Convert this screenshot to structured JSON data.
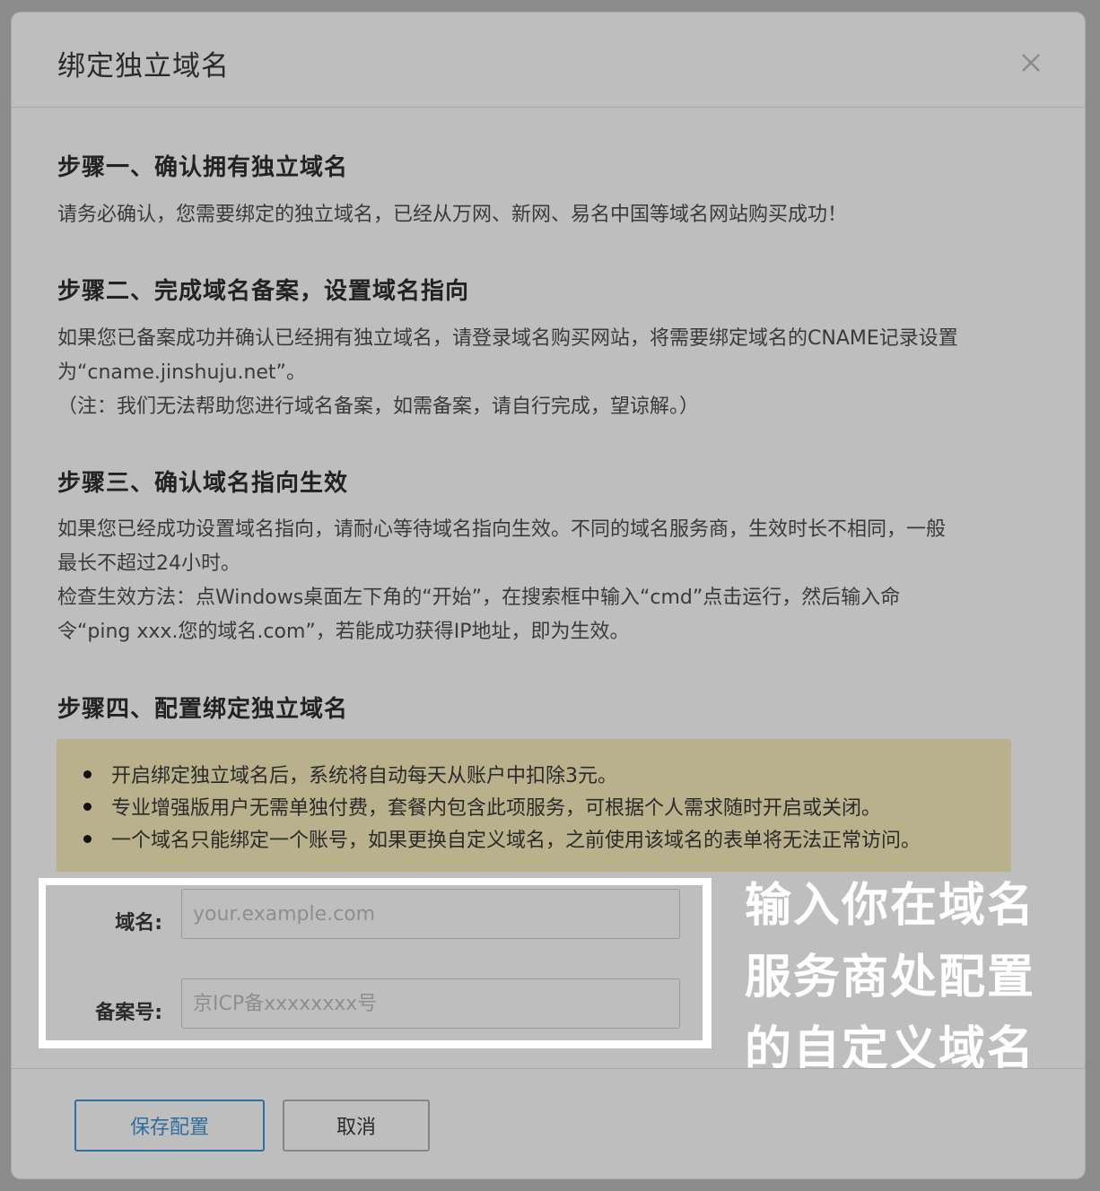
{
  "dialog": {
    "title": "绑定独立域名",
    "close_icon": "close-icon"
  },
  "steps": [
    {
      "title": "步骤一、确认拥有独立域名",
      "lines": [
        "请务必确认，您需要绑定的独立域名，已经从万网、新网、易名中国等域名网站购买成功！"
      ]
    },
    {
      "title": "步骤二、完成域名备案，设置域名指向",
      "lines": [
        "如果您已备案成功并确认已经拥有独立域名，请登录域名购买网站，将需要绑定域名的CNAME记录设置",
        "为“cname.jinshuju.net”。",
        "（注：我们无法帮助您进行域名备案，如需备案，请自行完成，望谅解。）"
      ]
    },
    {
      "title": "步骤三、确认域名指向生效",
      "lines": [
        "如果您已经成功设置域名指向，请耐心等待域名指向生效。不同的域名服务商，生效时长不相同，一般",
        "最长不超过24小时。",
        "检查生效方法：点Windows桌面左下角的“开始”，在搜索框中输入“cmd”点击运行，然后输入命",
        "令“ping xxx.您的域名.com”，若能成功获得IP地址，即为生效。"
      ]
    },
    {
      "title": "步骤四、配置绑定独立域名",
      "lines": []
    }
  ],
  "notice": {
    "items": [
      "开启绑定独立域名后，系统将自动每天从账户中扣除3元。",
      "专业增强版用户无需单独付费，套餐内包含此项服务，可根据个人需求随时开启或关闭。",
      "一个域名只能绑定一个账号，如果更换自定义域名，之前使用该域名的表单将无法正常访问。"
    ],
    "background_color": "#b9b18c"
  },
  "form": {
    "domain_label": "域名:",
    "domain_value": "",
    "domain_placeholder": "your.example.com",
    "icp_label": "备案号:",
    "icp_value": "",
    "icp_placeholder": "京ICP备xxxxxxxx号"
  },
  "annotation": {
    "lines": [
      "输入你在域名",
      "服务商处配置",
      "的自定义域名"
    ]
  },
  "footer": {
    "save_label": "保存配置",
    "cancel_label": "取消"
  },
  "colors": {
    "primary": "#2f6f9e",
    "overlay": "#8c8c8c",
    "modal_bg": "#bebebe"
  }
}
